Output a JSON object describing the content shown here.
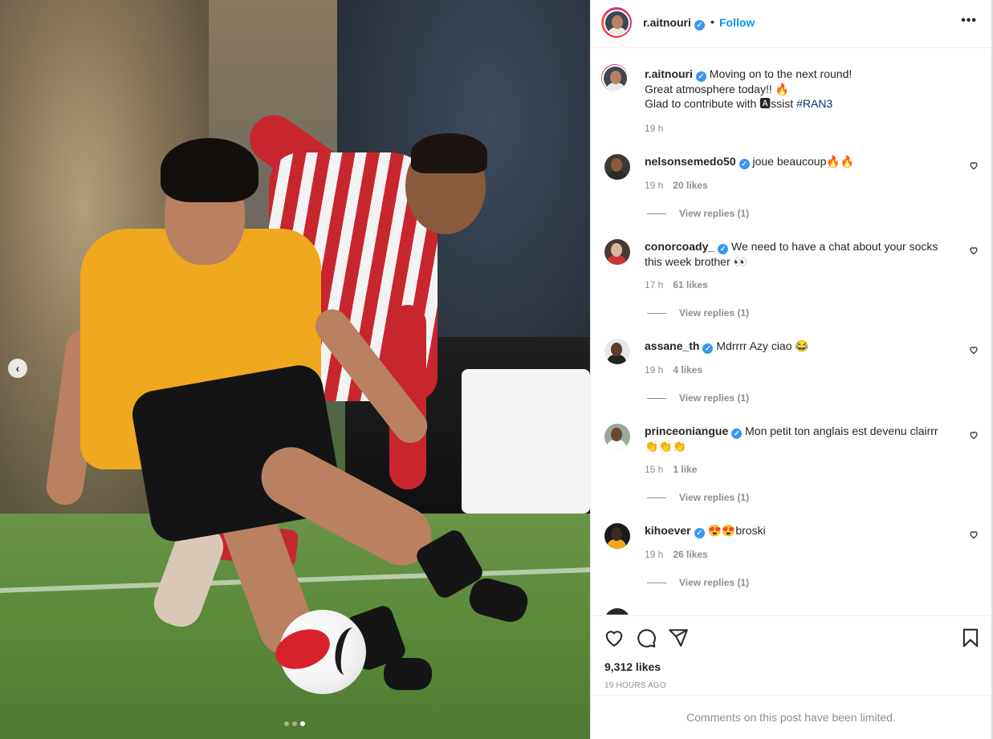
{
  "post": {
    "author": "r.aitnouri",
    "follow_label": "Follow",
    "more_label": "•••",
    "separator": "•",
    "carousel_prev": "‹",
    "carousel_index": 3,
    "carousel_count": 3
  },
  "caption": {
    "username": "r.aitnouri",
    "line1": "Moving on to the next round!",
    "line2": "Great atmosphere today!! 🔥",
    "line3_prefix": "Glad to contribute with 🅰ssist",
    "hashtag": "#RAN3",
    "time": "19 h"
  },
  "comments": [
    {
      "username": "nelsonsemedo50",
      "text": "joue beaucoup🔥🔥",
      "time": "19 h",
      "likes": "20 likes",
      "replies": "View replies (1)"
    },
    {
      "username": "conorcoady_",
      "text": "We need to have a chat about your socks this week brother 👀",
      "time": "17 h",
      "likes": "61 likes",
      "replies": "View replies (1)"
    },
    {
      "username": "assane_th",
      "text": "Mdrrrr Azy ciao 😂",
      "time": "19 h",
      "likes": "4 likes",
      "replies": "View replies (1)"
    },
    {
      "username": "princeoniangue",
      "text": "Mon petit ton anglais est devenu clairrr 👏👏👏",
      "time": "15 h",
      "likes": "1 like",
      "replies": "View replies (1)"
    },
    {
      "username": "kihoever",
      "text": "😍😍broski",
      "time": "19 h",
      "likes": "26 likes",
      "replies": "View replies (1)"
    }
  ],
  "footer": {
    "likes": "9,312 likes",
    "posted": "19 HOURS AGO",
    "limited_notice": "Comments on this post have been limited."
  },
  "icons": [
    "chevron-left-icon",
    "more-icon",
    "verified-icon",
    "heart-icon",
    "comment-icon",
    "share-icon",
    "bookmark-icon"
  ],
  "colors": {
    "follow": "#0095f6",
    "verified": "#3897f0",
    "hashtag": "#00376b",
    "muted": "#8e8e8e",
    "story_ring": "#e1306c"
  }
}
